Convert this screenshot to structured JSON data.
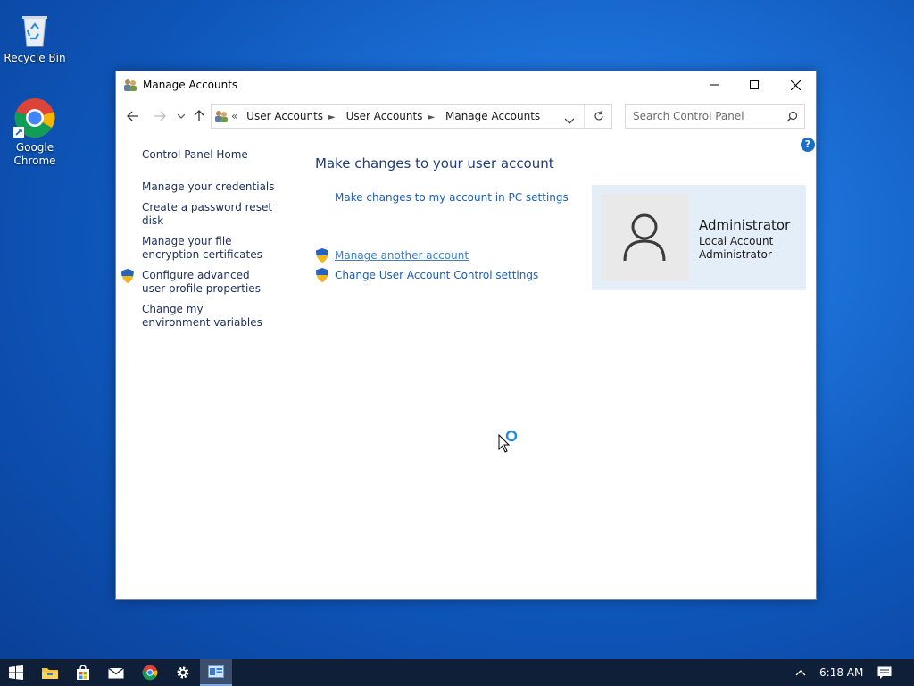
{
  "desktop": {
    "icons": [
      {
        "label": "Recycle Bin",
        "icon": "recycle-bin-icon"
      },
      {
        "label": "Google Chrome",
        "icon": "chrome-icon"
      }
    ]
  },
  "window": {
    "title": "Manage Accounts",
    "breadcrumb": [
      "User Accounts",
      "User Accounts",
      "Manage Accounts"
    ],
    "breadcrumb_overflow": "«",
    "search_placeholder": "Search Control Panel"
  },
  "left_nav": {
    "home": "Control Panel Home",
    "items": [
      {
        "label": "Manage your credentials",
        "shield": false
      },
      {
        "label": "Create a password reset disk",
        "shield": false
      },
      {
        "label": "Manage your file encryption certificates",
        "shield": false
      },
      {
        "label": "Configure advanced user profile properties",
        "shield": true
      },
      {
        "label": "Change my environment variables",
        "shield": false
      }
    ]
  },
  "main": {
    "heading": "Make changes to your user account",
    "links": [
      {
        "label": "Make changes to my account in PC settings",
        "shield": false
      },
      {
        "label": "Manage another account",
        "shield": true
      },
      {
        "label": "Change User Account Control settings",
        "shield": true
      }
    ]
  },
  "account": {
    "name": "Administrator",
    "type_line1": "Local Account",
    "type_line2": "Administrator"
  },
  "help": {
    "label": "?"
  },
  "taskbar": {
    "time": "6:18 AM",
    "items": [
      "start-icon",
      "file-explorer-icon",
      "store-icon",
      "mail-icon",
      "chrome-icon",
      "settings-icon",
      "control-panel-icon"
    ]
  },
  "colors": {
    "link": "#1c5db7",
    "heading": "#1e3d78",
    "card_bg": "#e4eef8",
    "taskbar": "#101f38"
  }
}
